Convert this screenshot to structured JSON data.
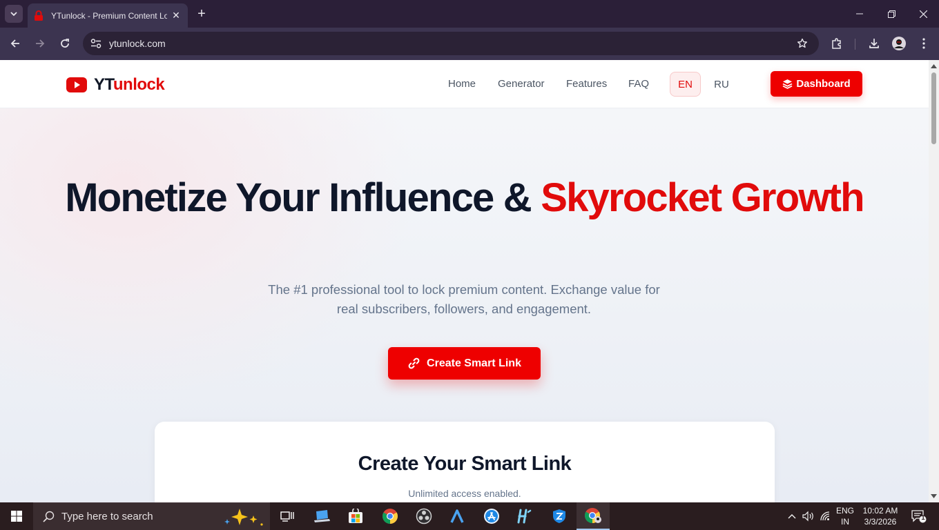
{
  "browser": {
    "tab_title": "YTunlock - Premium Content Locker",
    "url": "ytunlock.com"
  },
  "site": {
    "logo_prefix": "YT",
    "logo_suffix": "unlock",
    "nav": {
      "home": "Home",
      "generator": "Generator",
      "features": "Features",
      "faq": "FAQ"
    },
    "lang_en": "EN",
    "lang_ru": "RU",
    "dashboard_label": "Dashboard"
  },
  "hero": {
    "title_part1": "Monetize Your Influence & ",
    "title_accent": "Skyrocket Growth",
    "subtitle": "The #1 professional tool to lock premium content. Exchange value for real subscribers, followers, and engagement.",
    "cta_label": "Create Smart Link"
  },
  "card": {
    "title": "Create Your Smart Link",
    "subtitle": "Unlimited access enabled."
  },
  "taskbar": {
    "search_placeholder": "Type here to search",
    "lang_line1": "ENG",
    "lang_line2": "IN",
    "time": "10:02 AM",
    "date": "3/3/2026",
    "notification_count": "1"
  },
  "colors": {
    "brand_red": "#e10b0b",
    "button_red": "#ee0000",
    "heading": "#0f172a",
    "muted": "#64748b"
  }
}
